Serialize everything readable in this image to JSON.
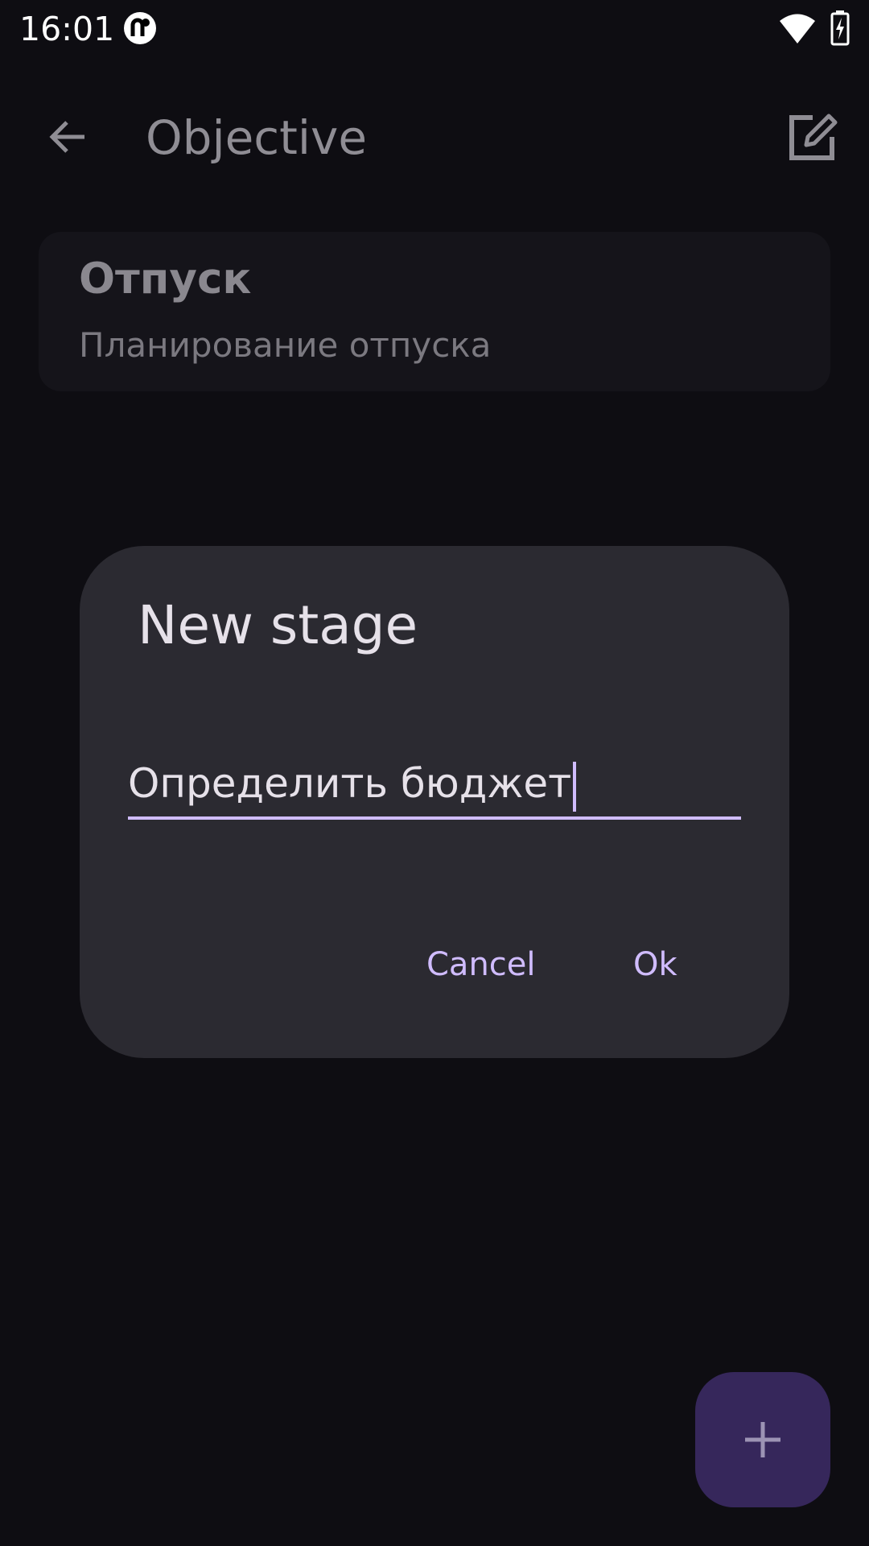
{
  "status_bar": {
    "time": "16:01",
    "icons": [
      "app-notification-icon",
      "wifi-icon",
      "battery-charging-icon"
    ]
  },
  "app_bar": {
    "title": "Objective",
    "back_icon": "arrow-back-icon",
    "edit_icon": "edit-icon"
  },
  "objective": {
    "title": "Отпуск",
    "description": "Планирование отпуска"
  },
  "dialog": {
    "title": "New stage",
    "input_value": "Определить бюджет",
    "cancel_label": "Cancel",
    "ok_label": "Ok"
  },
  "fab": {
    "icon": "plus-icon"
  },
  "colors": {
    "background": "#0e0d12",
    "card": "#15141a",
    "dialog": "#2b2a31",
    "accent": "#d0bcff",
    "fab": "#36275b"
  }
}
